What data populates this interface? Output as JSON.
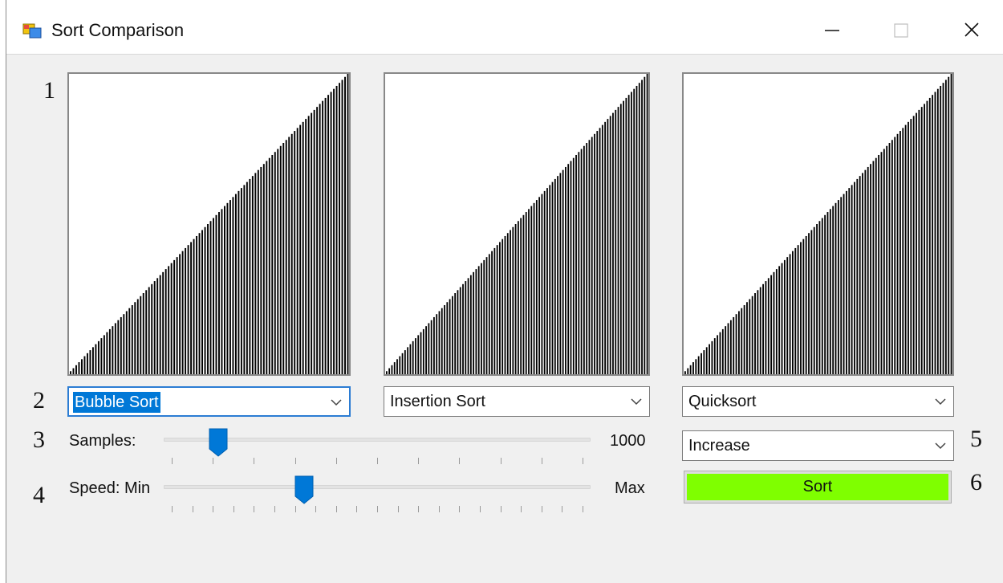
{
  "window": {
    "title": "Sort Comparison",
    "icons": {
      "app": "app-icon",
      "minimize": "minimize-icon",
      "maximize": "maximize-icon",
      "close": "close-icon"
    }
  },
  "annotations": [
    "1",
    "2",
    "3",
    "4",
    "5",
    "6"
  ],
  "panels": [
    {
      "algorithm": "Bubble Sort",
      "bar_count": 100,
      "order": "ascending"
    },
    {
      "algorithm": "Insertion Sort",
      "bar_count": 100,
      "order": "ascending"
    },
    {
      "algorithm": "Quicksort",
      "bar_count": 100,
      "order": "ascending"
    }
  ],
  "algorithm_selects": [
    {
      "value": "Bubble Sort",
      "focused": true
    },
    {
      "value": "Insertion Sort",
      "focused": false
    },
    {
      "value": "Quicksort",
      "focused": false
    }
  ],
  "samples": {
    "label": "Samples:",
    "max_label": "1000",
    "level": 0.11
  },
  "speed": {
    "label": "Speed: Min",
    "max_label": "Max",
    "level": 0.32
  },
  "order_select": {
    "value": "Increase"
  },
  "sort_button": {
    "label": "Sort",
    "color": "#7fff00"
  },
  "colors": {
    "accent": "#0078d7",
    "bars": "#000000",
    "panel_bg": "#ffffff",
    "window_bg": "#f0f0f0"
  }
}
